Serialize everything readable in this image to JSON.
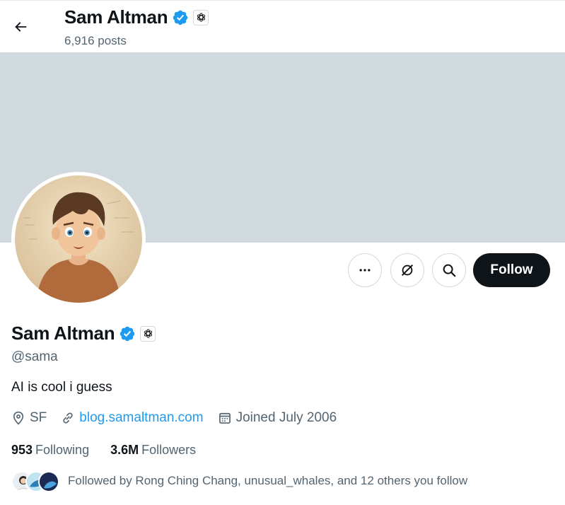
{
  "header": {
    "name": "Sam Altman",
    "posts": "6,916 posts"
  },
  "profile": {
    "name": "Sam Altman",
    "handle": "@sama",
    "bio": "AI is cool i guess",
    "location": "SF",
    "website": "blog.samaltman.com",
    "joined": "Joined July 2006"
  },
  "actions": {
    "follow_label": "Follow"
  },
  "counts": {
    "following_num": "953",
    "following_label": "Following",
    "followers_num": "3.6M",
    "followers_label": "Followers"
  },
  "followed_by": "Followed by Rong Ching Chang, unusual_whales, and 12 others you follow",
  "icons": [
    "back-arrow-icon",
    "verified-badge-icon",
    "openai-affiliate-icon",
    "more-icon",
    "grok-icon",
    "search-icon",
    "location-icon",
    "link-icon",
    "calendar-icon"
  ],
  "colors": {
    "banner": "#cfd9de",
    "accent": "#1d9bf0",
    "follow_button": "#0f1419",
    "secondary_text": "#536471"
  }
}
